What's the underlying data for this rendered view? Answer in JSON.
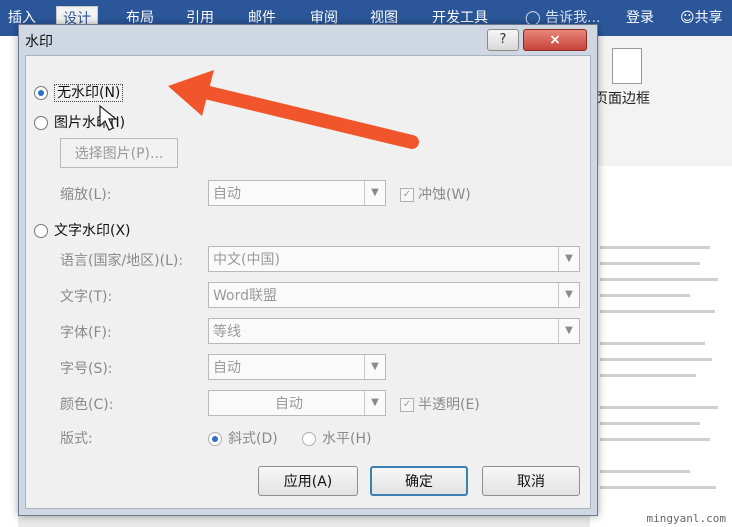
{
  "ribbon": {
    "tabs": [
      "插入",
      "设计",
      "布局",
      "引用",
      "邮件",
      "审阅",
      "视图",
      "开发工具"
    ],
    "active_tab": "设计",
    "tell_me": "告诉我...",
    "login": "登录",
    "share": "共享",
    "page_border": "页面边框"
  },
  "dialog": {
    "title": "水印",
    "help": "?",
    "close": "×",
    "no_watermark": "无水印(N)",
    "picture_watermark": "图片水印(I)",
    "select_picture": "选择图片(P)...",
    "scale_label": "缩放(L):",
    "scale_value": "自动",
    "washout_label": "冲蚀(W)",
    "text_watermark": "文字水印(X)",
    "language_label": "语言(国家/地区)(L):",
    "language_value": "中文(中国)",
    "text_label": "文字(T):",
    "text_value": "Word联盟",
    "font_label": "字体(F):",
    "font_value": "等线",
    "size_label": "字号(S):",
    "size_value": "自动",
    "color_label": "颜色(C):",
    "color_value": "自动",
    "semitransparent_label": "半透明(E)",
    "layout_label": "版式:",
    "diagonal_label": "斜式(D)",
    "horizontal_label": "水平(H)",
    "apply": "应用(A)",
    "ok": "确定",
    "cancel": "取消"
  },
  "footer": {
    "site": "mingyanl.com"
  },
  "colors": {
    "ribbon": "#2b579a",
    "annotation_arrow": "#f0552b",
    "close_button": "#c8433a"
  }
}
